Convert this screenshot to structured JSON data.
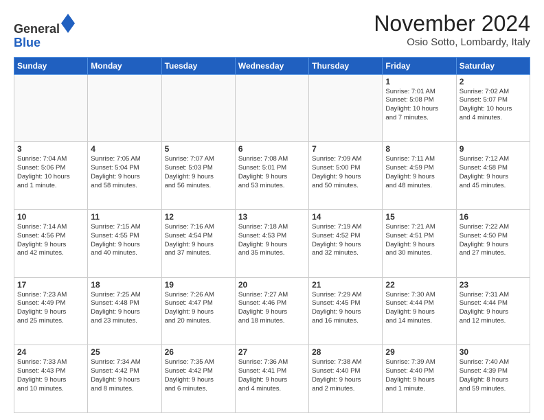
{
  "header": {
    "logo_line1": "General",
    "logo_line2": "Blue",
    "month": "November 2024",
    "location": "Osio Sotto, Lombardy, Italy"
  },
  "weekdays": [
    "Sunday",
    "Monday",
    "Tuesday",
    "Wednesday",
    "Thursday",
    "Friday",
    "Saturday"
  ],
  "weeks": [
    [
      {
        "day": "",
        "info": ""
      },
      {
        "day": "",
        "info": ""
      },
      {
        "day": "",
        "info": ""
      },
      {
        "day": "",
        "info": ""
      },
      {
        "day": "",
        "info": ""
      },
      {
        "day": "1",
        "info": "Sunrise: 7:01 AM\nSunset: 5:08 PM\nDaylight: 10 hours\nand 7 minutes."
      },
      {
        "day": "2",
        "info": "Sunrise: 7:02 AM\nSunset: 5:07 PM\nDaylight: 10 hours\nand 4 minutes."
      }
    ],
    [
      {
        "day": "3",
        "info": "Sunrise: 7:04 AM\nSunset: 5:06 PM\nDaylight: 10 hours\nand 1 minute."
      },
      {
        "day": "4",
        "info": "Sunrise: 7:05 AM\nSunset: 5:04 PM\nDaylight: 9 hours\nand 58 minutes."
      },
      {
        "day": "5",
        "info": "Sunrise: 7:07 AM\nSunset: 5:03 PM\nDaylight: 9 hours\nand 56 minutes."
      },
      {
        "day": "6",
        "info": "Sunrise: 7:08 AM\nSunset: 5:01 PM\nDaylight: 9 hours\nand 53 minutes."
      },
      {
        "day": "7",
        "info": "Sunrise: 7:09 AM\nSunset: 5:00 PM\nDaylight: 9 hours\nand 50 minutes."
      },
      {
        "day": "8",
        "info": "Sunrise: 7:11 AM\nSunset: 4:59 PM\nDaylight: 9 hours\nand 48 minutes."
      },
      {
        "day": "9",
        "info": "Sunrise: 7:12 AM\nSunset: 4:58 PM\nDaylight: 9 hours\nand 45 minutes."
      }
    ],
    [
      {
        "day": "10",
        "info": "Sunrise: 7:14 AM\nSunset: 4:56 PM\nDaylight: 9 hours\nand 42 minutes."
      },
      {
        "day": "11",
        "info": "Sunrise: 7:15 AM\nSunset: 4:55 PM\nDaylight: 9 hours\nand 40 minutes."
      },
      {
        "day": "12",
        "info": "Sunrise: 7:16 AM\nSunset: 4:54 PM\nDaylight: 9 hours\nand 37 minutes."
      },
      {
        "day": "13",
        "info": "Sunrise: 7:18 AM\nSunset: 4:53 PM\nDaylight: 9 hours\nand 35 minutes."
      },
      {
        "day": "14",
        "info": "Sunrise: 7:19 AM\nSunset: 4:52 PM\nDaylight: 9 hours\nand 32 minutes."
      },
      {
        "day": "15",
        "info": "Sunrise: 7:21 AM\nSunset: 4:51 PM\nDaylight: 9 hours\nand 30 minutes."
      },
      {
        "day": "16",
        "info": "Sunrise: 7:22 AM\nSunset: 4:50 PM\nDaylight: 9 hours\nand 27 minutes."
      }
    ],
    [
      {
        "day": "17",
        "info": "Sunrise: 7:23 AM\nSunset: 4:49 PM\nDaylight: 9 hours\nand 25 minutes."
      },
      {
        "day": "18",
        "info": "Sunrise: 7:25 AM\nSunset: 4:48 PM\nDaylight: 9 hours\nand 23 minutes."
      },
      {
        "day": "19",
        "info": "Sunrise: 7:26 AM\nSunset: 4:47 PM\nDaylight: 9 hours\nand 20 minutes."
      },
      {
        "day": "20",
        "info": "Sunrise: 7:27 AM\nSunset: 4:46 PM\nDaylight: 9 hours\nand 18 minutes."
      },
      {
        "day": "21",
        "info": "Sunrise: 7:29 AM\nSunset: 4:45 PM\nDaylight: 9 hours\nand 16 minutes."
      },
      {
        "day": "22",
        "info": "Sunrise: 7:30 AM\nSunset: 4:44 PM\nDaylight: 9 hours\nand 14 minutes."
      },
      {
        "day": "23",
        "info": "Sunrise: 7:31 AM\nSunset: 4:44 PM\nDaylight: 9 hours\nand 12 minutes."
      }
    ],
    [
      {
        "day": "24",
        "info": "Sunrise: 7:33 AM\nSunset: 4:43 PM\nDaylight: 9 hours\nand 10 minutes."
      },
      {
        "day": "25",
        "info": "Sunrise: 7:34 AM\nSunset: 4:42 PM\nDaylight: 9 hours\nand 8 minutes."
      },
      {
        "day": "26",
        "info": "Sunrise: 7:35 AM\nSunset: 4:42 PM\nDaylight: 9 hours\nand 6 minutes."
      },
      {
        "day": "27",
        "info": "Sunrise: 7:36 AM\nSunset: 4:41 PM\nDaylight: 9 hours\nand 4 minutes."
      },
      {
        "day": "28",
        "info": "Sunrise: 7:38 AM\nSunset: 4:40 PM\nDaylight: 9 hours\nand 2 minutes."
      },
      {
        "day": "29",
        "info": "Sunrise: 7:39 AM\nSunset: 4:40 PM\nDaylight: 9 hours\nand 1 minute."
      },
      {
        "day": "30",
        "info": "Sunrise: 7:40 AM\nSunset: 4:39 PM\nDaylight: 8 hours\nand 59 minutes."
      }
    ]
  ]
}
